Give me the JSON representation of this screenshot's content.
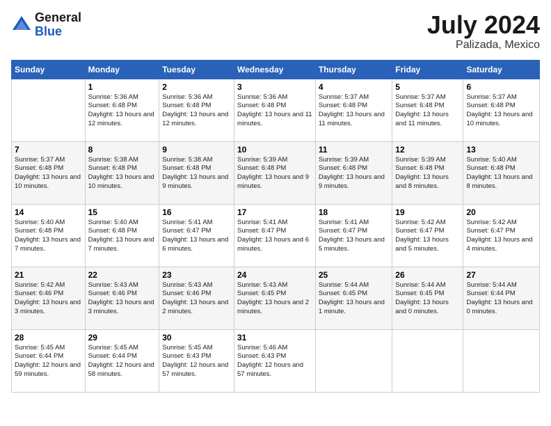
{
  "logo": {
    "general": "General",
    "blue": "Blue"
  },
  "title": {
    "month": "July 2024",
    "location": "Palizada, Mexico"
  },
  "headers": [
    "Sunday",
    "Monday",
    "Tuesday",
    "Wednesday",
    "Thursday",
    "Friday",
    "Saturday"
  ],
  "weeks": [
    [
      {
        "day": "",
        "info": ""
      },
      {
        "day": "1",
        "info": "Sunrise: 5:36 AM\nSunset: 6:48 PM\nDaylight: 13 hours and 12 minutes."
      },
      {
        "day": "2",
        "info": "Sunrise: 5:36 AM\nSunset: 6:48 PM\nDaylight: 13 hours and 12 minutes."
      },
      {
        "day": "3",
        "info": "Sunrise: 5:36 AM\nSunset: 6:48 PM\nDaylight: 13 hours and 11 minutes."
      },
      {
        "day": "4",
        "info": "Sunrise: 5:37 AM\nSunset: 6:48 PM\nDaylight: 13 hours and 11 minutes."
      },
      {
        "day": "5",
        "info": "Sunrise: 5:37 AM\nSunset: 6:48 PM\nDaylight: 13 hours and 11 minutes."
      },
      {
        "day": "6",
        "info": "Sunrise: 5:37 AM\nSunset: 6:48 PM\nDaylight: 13 hours and 10 minutes."
      }
    ],
    [
      {
        "day": "7",
        "info": "Sunrise: 5:37 AM\nSunset: 6:48 PM\nDaylight: 13 hours and 10 minutes."
      },
      {
        "day": "8",
        "info": "Sunrise: 5:38 AM\nSunset: 6:48 PM\nDaylight: 13 hours and 10 minutes."
      },
      {
        "day": "9",
        "info": "Sunrise: 5:38 AM\nSunset: 6:48 PM\nDaylight: 13 hours and 9 minutes."
      },
      {
        "day": "10",
        "info": "Sunrise: 5:39 AM\nSunset: 6:48 PM\nDaylight: 13 hours and 9 minutes."
      },
      {
        "day": "11",
        "info": "Sunrise: 5:39 AM\nSunset: 6:48 PM\nDaylight: 13 hours and 9 minutes."
      },
      {
        "day": "12",
        "info": "Sunrise: 5:39 AM\nSunset: 6:48 PM\nDaylight: 13 hours and 8 minutes."
      },
      {
        "day": "13",
        "info": "Sunrise: 5:40 AM\nSunset: 6:48 PM\nDaylight: 13 hours and 8 minutes."
      }
    ],
    [
      {
        "day": "14",
        "info": "Sunrise: 5:40 AM\nSunset: 6:48 PM\nDaylight: 13 hours and 7 minutes."
      },
      {
        "day": "15",
        "info": "Sunrise: 5:40 AM\nSunset: 6:48 PM\nDaylight: 13 hours and 7 minutes."
      },
      {
        "day": "16",
        "info": "Sunrise: 5:41 AM\nSunset: 6:47 PM\nDaylight: 13 hours and 6 minutes."
      },
      {
        "day": "17",
        "info": "Sunrise: 5:41 AM\nSunset: 6:47 PM\nDaylight: 13 hours and 6 minutes."
      },
      {
        "day": "18",
        "info": "Sunrise: 5:41 AM\nSunset: 6:47 PM\nDaylight: 13 hours and 5 minutes."
      },
      {
        "day": "19",
        "info": "Sunrise: 5:42 AM\nSunset: 6:47 PM\nDaylight: 13 hours and 5 minutes."
      },
      {
        "day": "20",
        "info": "Sunrise: 5:42 AM\nSunset: 6:47 PM\nDaylight: 13 hours and 4 minutes."
      }
    ],
    [
      {
        "day": "21",
        "info": "Sunrise: 5:42 AM\nSunset: 6:46 PM\nDaylight: 13 hours and 3 minutes."
      },
      {
        "day": "22",
        "info": "Sunrise: 5:43 AM\nSunset: 6:46 PM\nDaylight: 13 hours and 3 minutes."
      },
      {
        "day": "23",
        "info": "Sunrise: 5:43 AM\nSunset: 6:46 PM\nDaylight: 13 hours and 2 minutes."
      },
      {
        "day": "24",
        "info": "Sunrise: 5:43 AM\nSunset: 6:45 PM\nDaylight: 13 hours and 2 minutes."
      },
      {
        "day": "25",
        "info": "Sunrise: 5:44 AM\nSunset: 6:45 PM\nDaylight: 13 hours and 1 minute."
      },
      {
        "day": "26",
        "info": "Sunrise: 5:44 AM\nSunset: 6:45 PM\nDaylight: 13 hours and 0 minutes."
      },
      {
        "day": "27",
        "info": "Sunrise: 5:44 AM\nSunset: 6:44 PM\nDaylight: 13 hours and 0 minutes."
      }
    ],
    [
      {
        "day": "28",
        "info": "Sunrise: 5:45 AM\nSunset: 6:44 PM\nDaylight: 12 hours and 59 minutes."
      },
      {
        "day": "29",
        "info": "Sunrise: 5:45 AM\nSunset: 6:44 PM\nDaylight: 12 hours and 58 minutes."
      },
      {
        "day": "30",
        "info": "Sunrise: 5:45 AM\nSunset: 6:43 PM\nDaylight: 12 hours and 57 minutes."
      },
      {
        "day": "31",
        "info": "Sunrise: 5:46 AM\nSunset: 6:43 PM\nDaylight: 12 hours and 57 minutes."
      },
      {
        "day": "",
        "info": ""
      },
      {
        "day": "",
        "info": ""
      },
      {
        "day": "",
        "info": ""
      }
    ]
  ]
}
